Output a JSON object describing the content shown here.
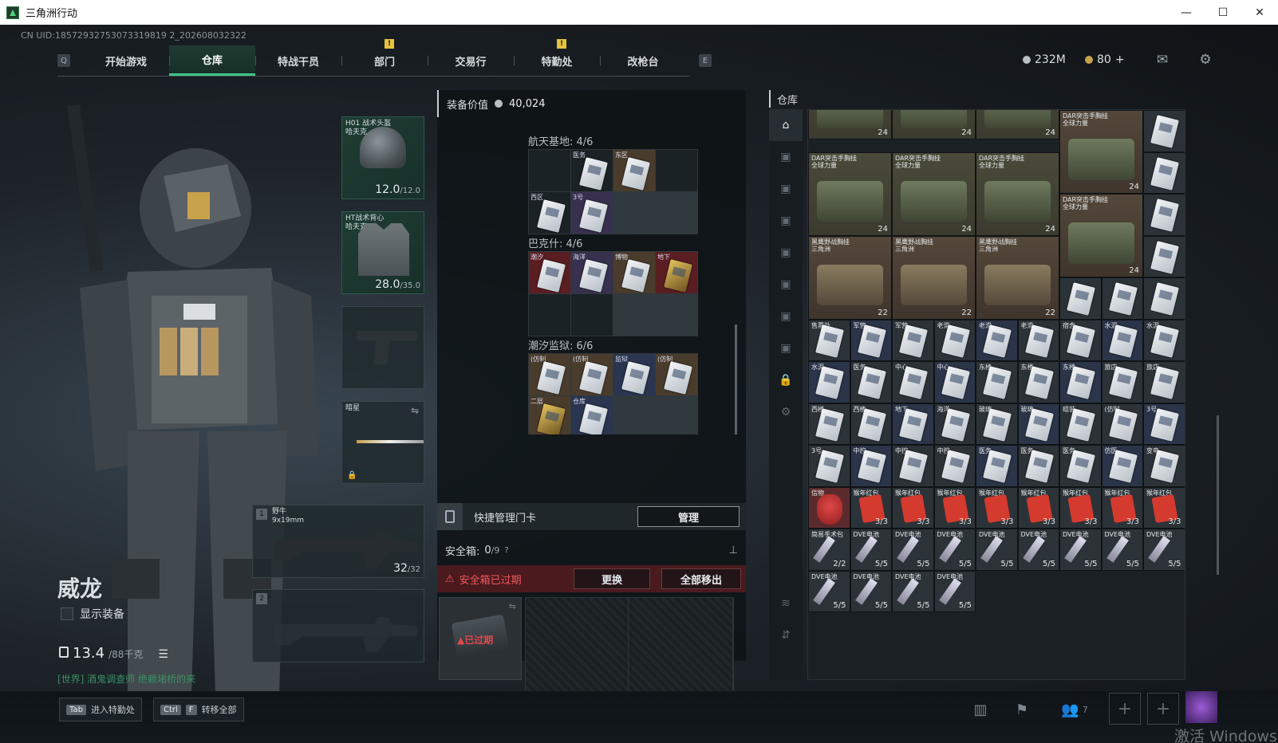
{
  "window": {
    "title": "三角洲行动",
    "min": "—",
    "max": "☐",
    "close": "✕"
  },
  "uid": "CN UID:18572932753073319819 2_202608032322",
  "nav": {
    "left_key": "Q",
    "right_key": "E",
    "tabs": [
      {
        "label": "开始游戏"
      },
      {
        "label": "仓库",
        "active": true
      },
      {
        "label": "特战干员"
      },
      {
        "label": "部门",
        "warn": "!"
      },
      {
        "label": "交易行"
      },
      {
        "label": "特勤处",
        "warn": "!"
      },
      {
        "label": "改枪台"
      }
    ]
  },
  "currency": {
    "silver": "232M",
    "gold": "80",
    "add": "+"
  },
  "character": {
    "name": "威龙",
    "show_equip": "显示装备",
    "weight": "13.4",
    "weight_max": "/88千克",
    "chat": "[世界] 酒鬼调查师 绝赖堵桥的来"
  },
  "equipment": {
    "helmet": {
      "label": "H01 战术头盔\n哈夫克",
      "durability": "12.0",
      "max": "/12.0"
    },
    "armor": {
      "label": "HT战术背心\n哈夫克",
      "durability": "28.0",
      "max": "/35.0"
    },
    "melee": {
      "label": "暗星"
    },
    "primary": {
      "index": "1",
      "label": "野牛\n9x19mm",
      "ammo": "32",
      "ammo_max": "/32"
    },
    "secondary": {
      "index": "2"
    }
  },
  "middle": {
    "value_label": "装备价值",
    "value": "40,024",
    "groups": [
      {
        "title": "航天基地: 4/6"
      },
      {
        "title": "巴克什: 4/6"
      },
      {
        "title": "潮汐监狱: 6/6"
      }
    ],
    "g1": [
      "",
      "医务",
      "东区",
      "",
      "西区",
      "3号",
      "",
      ""
    ],
    "g2": [
      "潮汐",
      "海洋",
      "博物",
      "地下",
      "",
      "",
      "",
      ""
    ],
    "g3": [
      "(仿制",
      "(仿制",
      "监狱",
      "(仿制",
      "二层",
      "仓库",
      "",
      ""
    ],
    "quick_label": "快捷管理门卡",
    "manage": "管理",
    "safe_label": "安全箱:",
    "safe_count": "0",
    "safe_max": "/9",
    "safe_help": "?",
    "expired_text": "安全箱已过期",
    "replace": "更换",
    "move_all": "全部移出",
    "safe_tag": "已过期"
  },
  "warehouse": {
    "title": "仓库",
    "bag1": "DAR突击手胸挂\n全球力量",
    "bag2": "黑鹰野战胸挂\n三角洲",
    "q24": "24",
    "q22": "22",
    "q33": "3/3",
    "q55": "5/5",
    "q22b": "2/2",
    "labels": [
      "售票处",
      "军营",
      "军营",
      "老滑",
      "老滑",
      "老滑",
      "宿舍",
      "水泥",
      "水泥",
      "水泥",
      "医务",
      "中心",
      "中心",
      "东楼",
      "东楼",
      "东楼",
      "旅店",
      "旅店",
      "西楼",
      "西楼",
      "地下",
      "海洋",
      "玻璃",
      "玻璃",
      "组装",
      "(仿制",
      "3号",
      "3号",
      "中控",
      "中控",
      "中控",
      "医务",
      "医务",
      "医务",
      "仿医",
      "变电",
      "信物",
      "猴年红包",
      "猴年红包",
      "猴年红包",
      "猴年红包",
      "猴年红包",
      "猴年红包",
      "猴年红包",
      "猴年红包",
      "简易手术包",
      "DVE电池",
      "DVE电池",
      "DVE电池",
      "DVE电池",
      "DVE电池",
      "DVE电池",
      "DVE电池",
      "DVE电池",
      "DVE电池",
      "DVE电池",
      "DVE电池",
      "DVE电池"
    ],
    "side_icons": [
      "home-icon",
      "tab1-icon",
      "tab2-icon",
      "tab3-icon",
      "tab4-icon",
      "tab5-icon",
      "tab6-icon",
      "tab7-icon",
      "lock-icon",
      "gear-icon"
    ]
  },
  "bottom": {
    "tab_key": "Tab",
    "tab_label": "进入特勤处",
    "ctrl_key": "Ctrl",
    "f_key": "F",
    "f_label": "转移全部",
    "friends": "7",
    "watermark": "激活 Windows"
  }
}
